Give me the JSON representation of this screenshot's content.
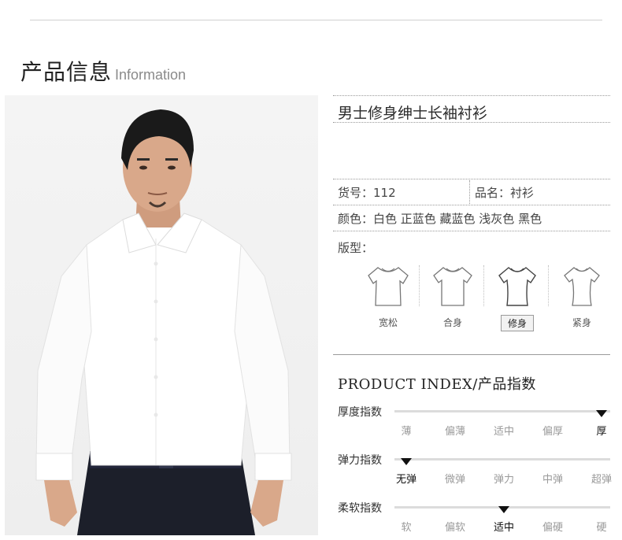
{
  "header": {
    "title": "产品信息",
    "subtitle": "Information"
  },
  "product": {
    "name": "男士修身绅士长袖衬衫",
    "sku_label": "货号：112",
    "category_label": "品名：衬衫",
    "colors_label": "颜色：白色 正蓝色 藏蓝色 浅灰色 黑色",
    "fit_label": "版型："
  },
  "fits": [
    {
      "label": "宽松",
      "icon": "loose-shirt-icon",
      "selected": false
    },
    {
      "label": "合身",
      "icon": "regular-shirt-icon",
      "selected": false
    },
    {
      "label": "修身",
      "icon": "slim-shirt-icon",
      "selected": true
    },
    {
      "label": "紧身",
      "icon": "tight-shirt-icon",
      "selected": false
    }
  ],
  "index": {
    "title_en": "PRODUCT INDEX",
    "title_cn": "/产品指数",
    "rows": [
      {
        "label": "厚度指数",
        "levels": [
          "薄",
          "偏薄",
          "适中",
          "偏厚",
          "厚"
        ],
        "selected": 4
      },
      {
        "label": "弹力指数",
        "levels": [
          "无弹",
          "微弹",
          "弹力",
          "中弹",
          "超弹"
        ],
        "selected": 0
      },
      {
        "label": "柔软指数",
        "levels": [
          "软",
          "偏软",
          "适中",
          "偏硬",
          "硬"
        ],
        "selected": 2
      }
    ]
  },
  "colors": {
    "marker": "#111111",
    "track": "#dcdcdc",
    "shirt": "#ffffff",
    "pants": "#1c1f2a",
    "hair": "#1a1a1a",
    "skin": "#d9a88a"
  }
}
